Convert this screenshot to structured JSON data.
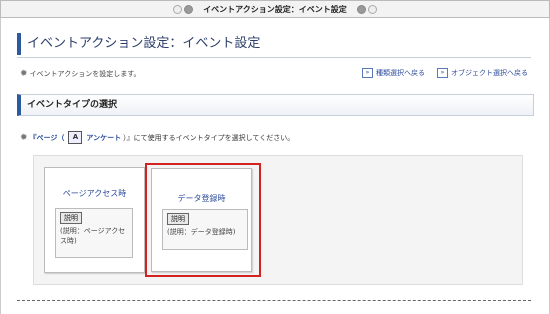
{
  "window": {
    "title": "イベントアクション設定：イベント設定"
  },
  "page": {
    "title": "イベントアクション設定：イベント設定"
  },
  "info": {
    "text": "イベントアクションを設定します。",
    "links": [
      "種類選択へ戻る",
      "オブジェクト選択へ戻る"
    ]
  },
  "section": {
    "title": "イベントタイプの選択"
  },
  "instruction": {
    "prefix": "『ページ（",
    "page_icon": "アンケート",
    "suffix": "）』にて使用するイベントタイプを選択してください。"
  },
  "cards": [
    {
      "title": "ページアクセス時",
      "desc_btn": "説明",
      "desc": "(説明：ページアクセス時)"
    },
    {
      "title": "データ登録時",
      "desc_btn": "説明",
      "desc": "(説明：データ登録時)"
    }
  ]
}
